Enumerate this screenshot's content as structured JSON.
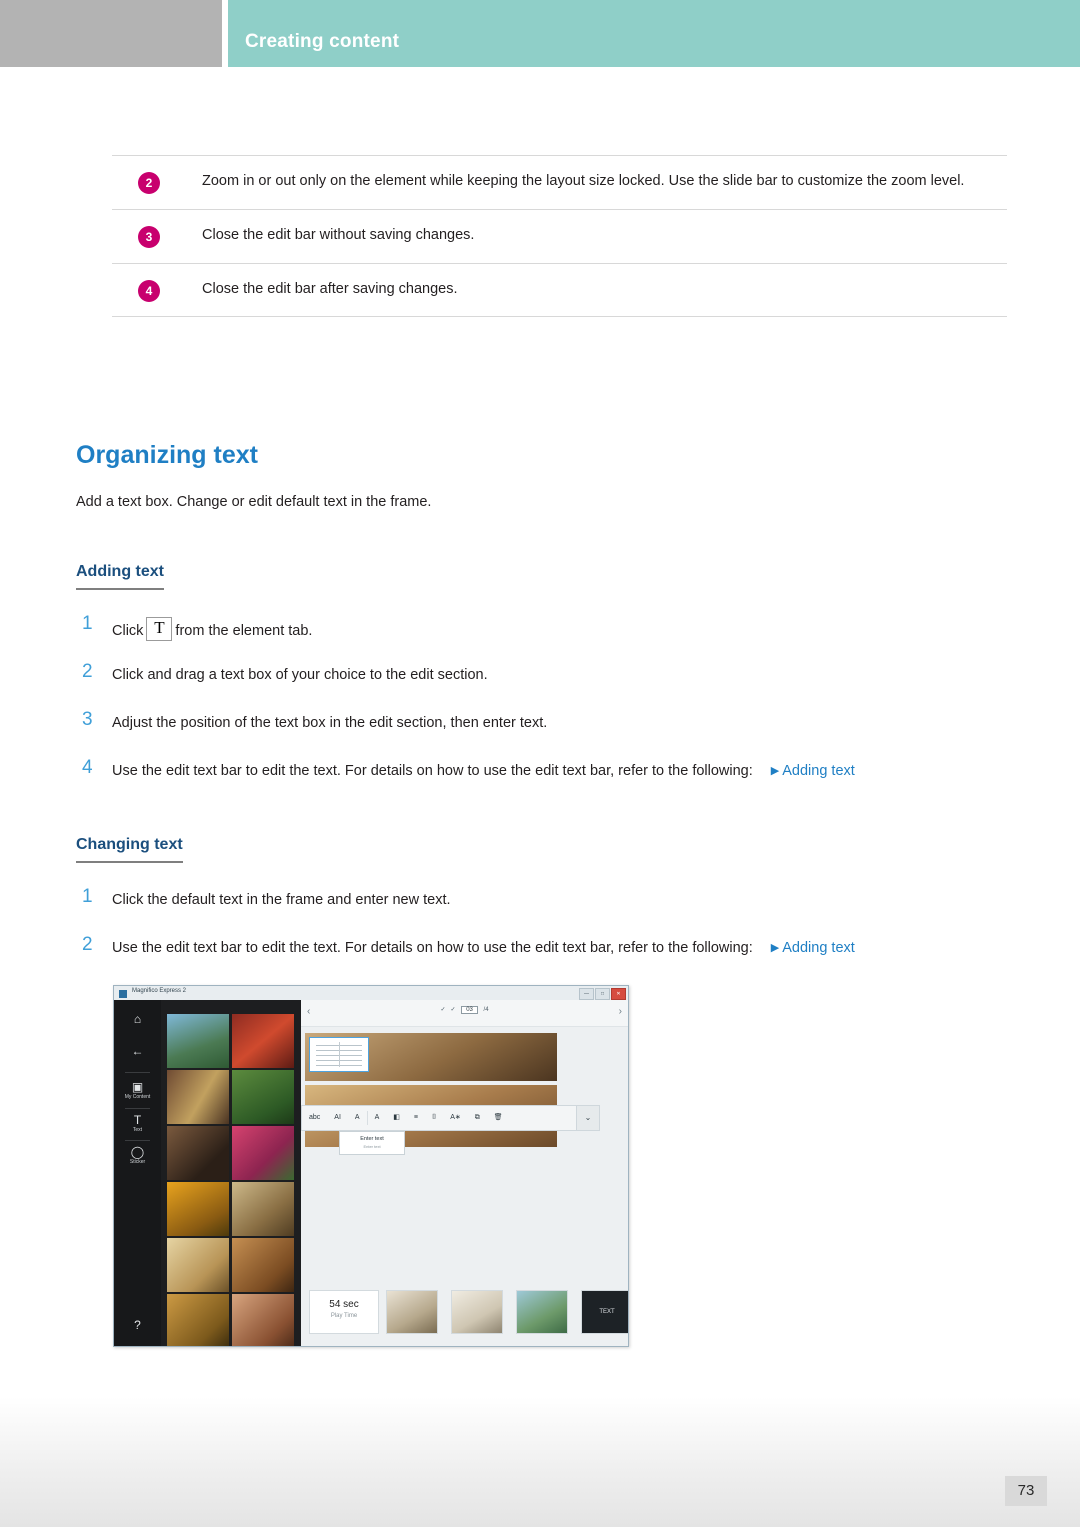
{
  "header": {
    "title": "Creating content"
  },
  "callouts": [
    {
      "num": "2",
      "text": "Zoom in or out only on the element while keeping the layout size locked. Use the slide bar to customize the zoom level."
    },
    {
      "num": "3",
      "text": "Close the edit bar without saving changes."
    },
    {
      "num": "4",
      "text": "Close the edit bar after saving changes."
    }
  ],
  "section": {
    "title": "Organizing text",
    "intro": "Add a text box. Change or edit default text in the frame."
  },
  "adding": {
    "heading": "Adding text",
    "steps": [
      {
        "num": "1",
        "pre": "Click",
        "icon": "text-tool-icon",
        "post": "from the element tab.",
        "link": ""
      },
      {
        "num": "2",
        "pre": "Click and drag a text box of your choice to the edit section.",
        "post": "",
        "link": ""
      },
      {
        "num": "3",
        "pre": "Adjust the position of the text box in the edit section, then enter text.",
        "post": "",
        "link": ""
      },
      {
        "num": "4",
        "pre": "Use the edit text bar to edit the text. For details on how to use the edit text bar, refer to the following:",
        "post": "",
        "link": "Adding text"
      }
    ]
  },
  "changing": {
    "heading": "Changing text",
    "steps": [
      {
        "num": "1",
        "pre": "Click the default text in the frame and enter new text.",
        "post": "",
        "link": ""
      },
      {
        "num": "2",
        "pre": "Use the edit text bar to edit the text. For details on how to use the edit text bar, refer to the following:",
        "post": "",
        "link": "Adding text"
      }
    ]
  },
  "app": {
    "window_title": "Magnifico Express 2",
    "window_buttons": [
      "—",
      "□",
      "✕"
    ],
    "rail": [
      {
        "glyph": "⌂",
        "label": ""
      },
      {
        "glyph": "←",
        "label": ""
      },
      {
        "glyph": "▣",
        "label": "My Content"
      },
      {
        "glyph": "T",
        "label": "Text"
      },
      {
        "glyph": "◯",
        "label": "Sticker"
      },
      {
        "glyph": "?",
        "label": ""
      }
    ],
    "topbar": {
      "left_chevron": "‹",
      "right_chevron": "›",
      "check_marks": [
        "✓",
        "✓"
      ],
      "page_current": "03",
      "page_total": "/4",
      "search_icon": "⌕",
      "folder_icon": "▤",
      "menu_icon": "☰"
    },
    "edit_bar": {
      "items": [
        "abc",
        "AI",
        "A",
        "A",
        "◧",
        "≡",
        "⌷",
        "A∗",
        "⧉",
        "🗑"
      ],
      "confirm": "⌄"
    },
    "text_frame_placeholder": {
      "line1": "Enter text",
      "line2": "Enter text"
    },
    "play_time": {
      "value": "54 sec",
      "label": "Play Time"
    },
    "strip_labels": [
      "",
      "",
      "",
      "TEXT"
    ]
  },
  "footer": {
    "page_number": "73"
  }
}
